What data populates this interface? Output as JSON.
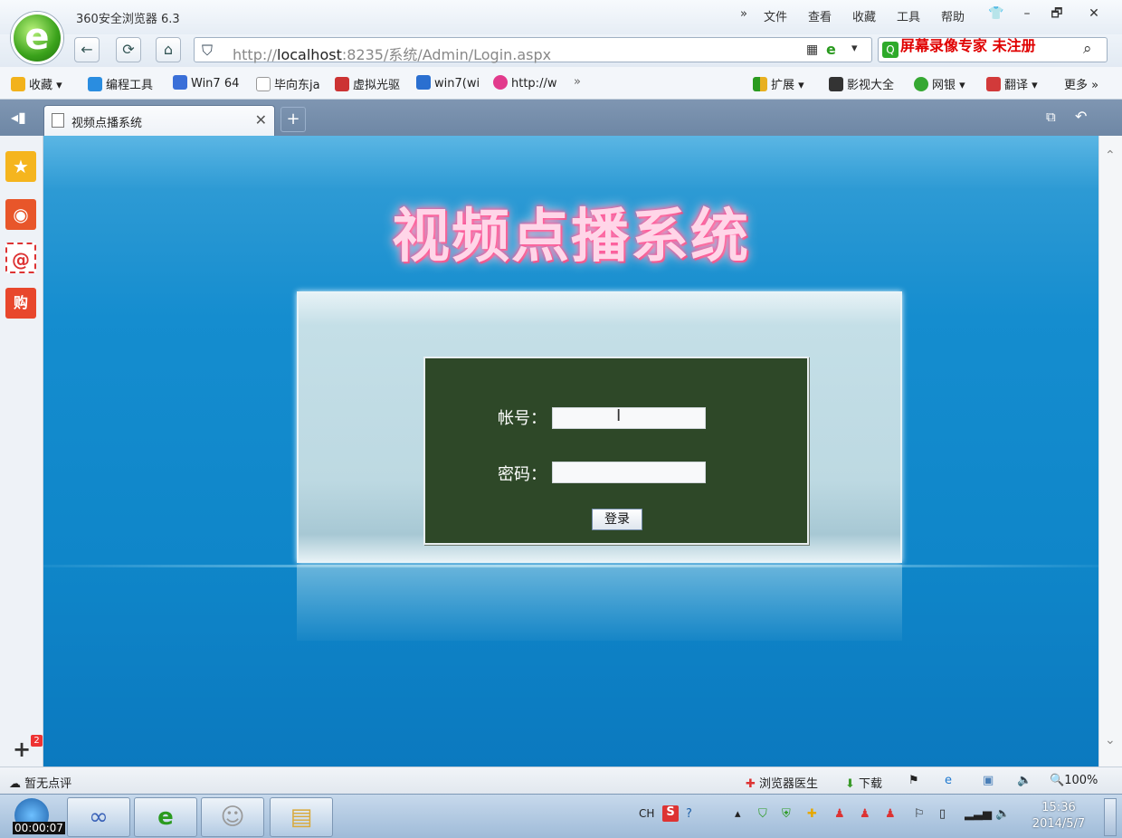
{
  "app": {
    "title": "360安全浏览器 6.3"
  },
  "menu": {
    "chevron": "»",
    "items": [
      "文件",
      "查看",
      "收藏",
      "工具",
      "帮助"
    ]
  },
  "window_controls": {
    "skin": "👕",
    "minimize": "–",
    "restore": "🗗",
    "close": "✕"
  },
  "address_bar": {
    "scheme": "http://",
    "host": "localhost",
    "rest": ":8235/系统/Admin/Login.aspx"
  },
  "search_box": {
    "placeholder": ""
  },
  "watermark": "屏幕录像专家 未注册",
  "bookmarks": {
    "favorites": "收藏",
    "items": [
      "编程工具",
      "Win7 64",
      "毕向东ja",
      "虚拟光驱",
      "win7(wi",
      "http://w"
    ],
    "overflow": "»",
    "right_items": [
      "扩展",
      "影视大全",
      "网银",
      "翻译",
      "更多"
    ]
  },
  "tab": {
    "title": "视频点播系统",
    "close": "✕",
    "new": "+"
  },
  "page": {
    "heading": "视频点播系统",
    "form": {
      "account_label": "帐号：",
      "password_label": "密码：",
      "account_value": "",
      "password_value": "",
      "login_button": "登录"
    }
  },
  "sidebar": {
    "add": "+",
    "badge": "2"
  },
  "status_bar": {
    "left": "暂无点评",
    "browser_doctor": "浏览器医生",
    "download": "下载",
    "zoom": "100%"
  },
  "taskbar": {
    "recording_timer": "00:00:07",
    "tray_lang": "CH",
    "time": "15:36",
    "date": "2014/5/7"
  },
  "colors": {
    "content_bg": "#158dcf",
    "form_bg": "#2e4828",
    "heading_glow": "#ff4f93",
    "watermark": "#e00000"
  }
}
